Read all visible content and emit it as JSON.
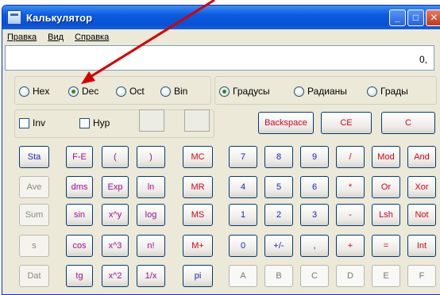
{
  "window": {
    "title": "Калькулятор"
  },
  "titlebar_buttons": {
    "minimize": "_",
    "maximize": "□",
    "close": "✕"
  },
  "menu": [
    "Правка",
    "Вид",
    "Справка"
  ],
  "display": {
    "value": "0,"
  },
  "number_system": {
    "options": [
      "Hex",
      "Dec",
      "Oct",
      "Bin"
    ],
    "selected": "Dec"
  },
  "angle_units": {
    "options": [
      "Градусы",
      "Радианы",
      "Грады"
    ],
    "selected": "Градусы"
  },
  "checkboxes": {
    "inv": "Inv",
    "hyp": "Hyp"
  },
  "edit_buttons": {
    "backspace": "Backspace",
    "ce": "CE",
    "c": "C"
  },
  "stat_buttons": [
    "Sta",
    "Ave",
    "Sum",
    "s",
    "Dat"
  ],
  "sci_buttons": [
    [
      "F-E",
      "(",
      ")"
    ],
    [
      "dms",
      "Exp",
      "ln"
    ],
    [
      "sin",
      "x^y",
      "log"
    ],
    [
      "cos",
      "x^3",
      "n!"
    ],
    [
      "tg",
      "x^2",
      "1/x"
    ]
  ],
  "memory_buttons": [
    "MC",
    "MR",
    "MS",
    "M+",
    "pi"
  ],
  "numpad": [
    [
      "7",
      "8",
      "9",
      "/",
      "Mod",
      "And"
    ],
    [
      "4",
      "5",
      "6",
      "*",
      "Or",
      "Xor"
    ],
    [
      "1",
      "2",
      "3",
      "-",
      "Lsh",
      "Not"
    ],
    [
      "0",
      "+/-",
      ",",
      "+",
      "=",
      "Int"
    ],
    [
      "A",
      "B",
      "C",
      "D",
      "E",
      "F"
    ]
  ],
  "colors": {
    "red_label": "#d4001c",
    "blue_label": "#1a24b8",
    "pink_label": "#a0108c",
    "arrow": "#d40000"
  }
}
